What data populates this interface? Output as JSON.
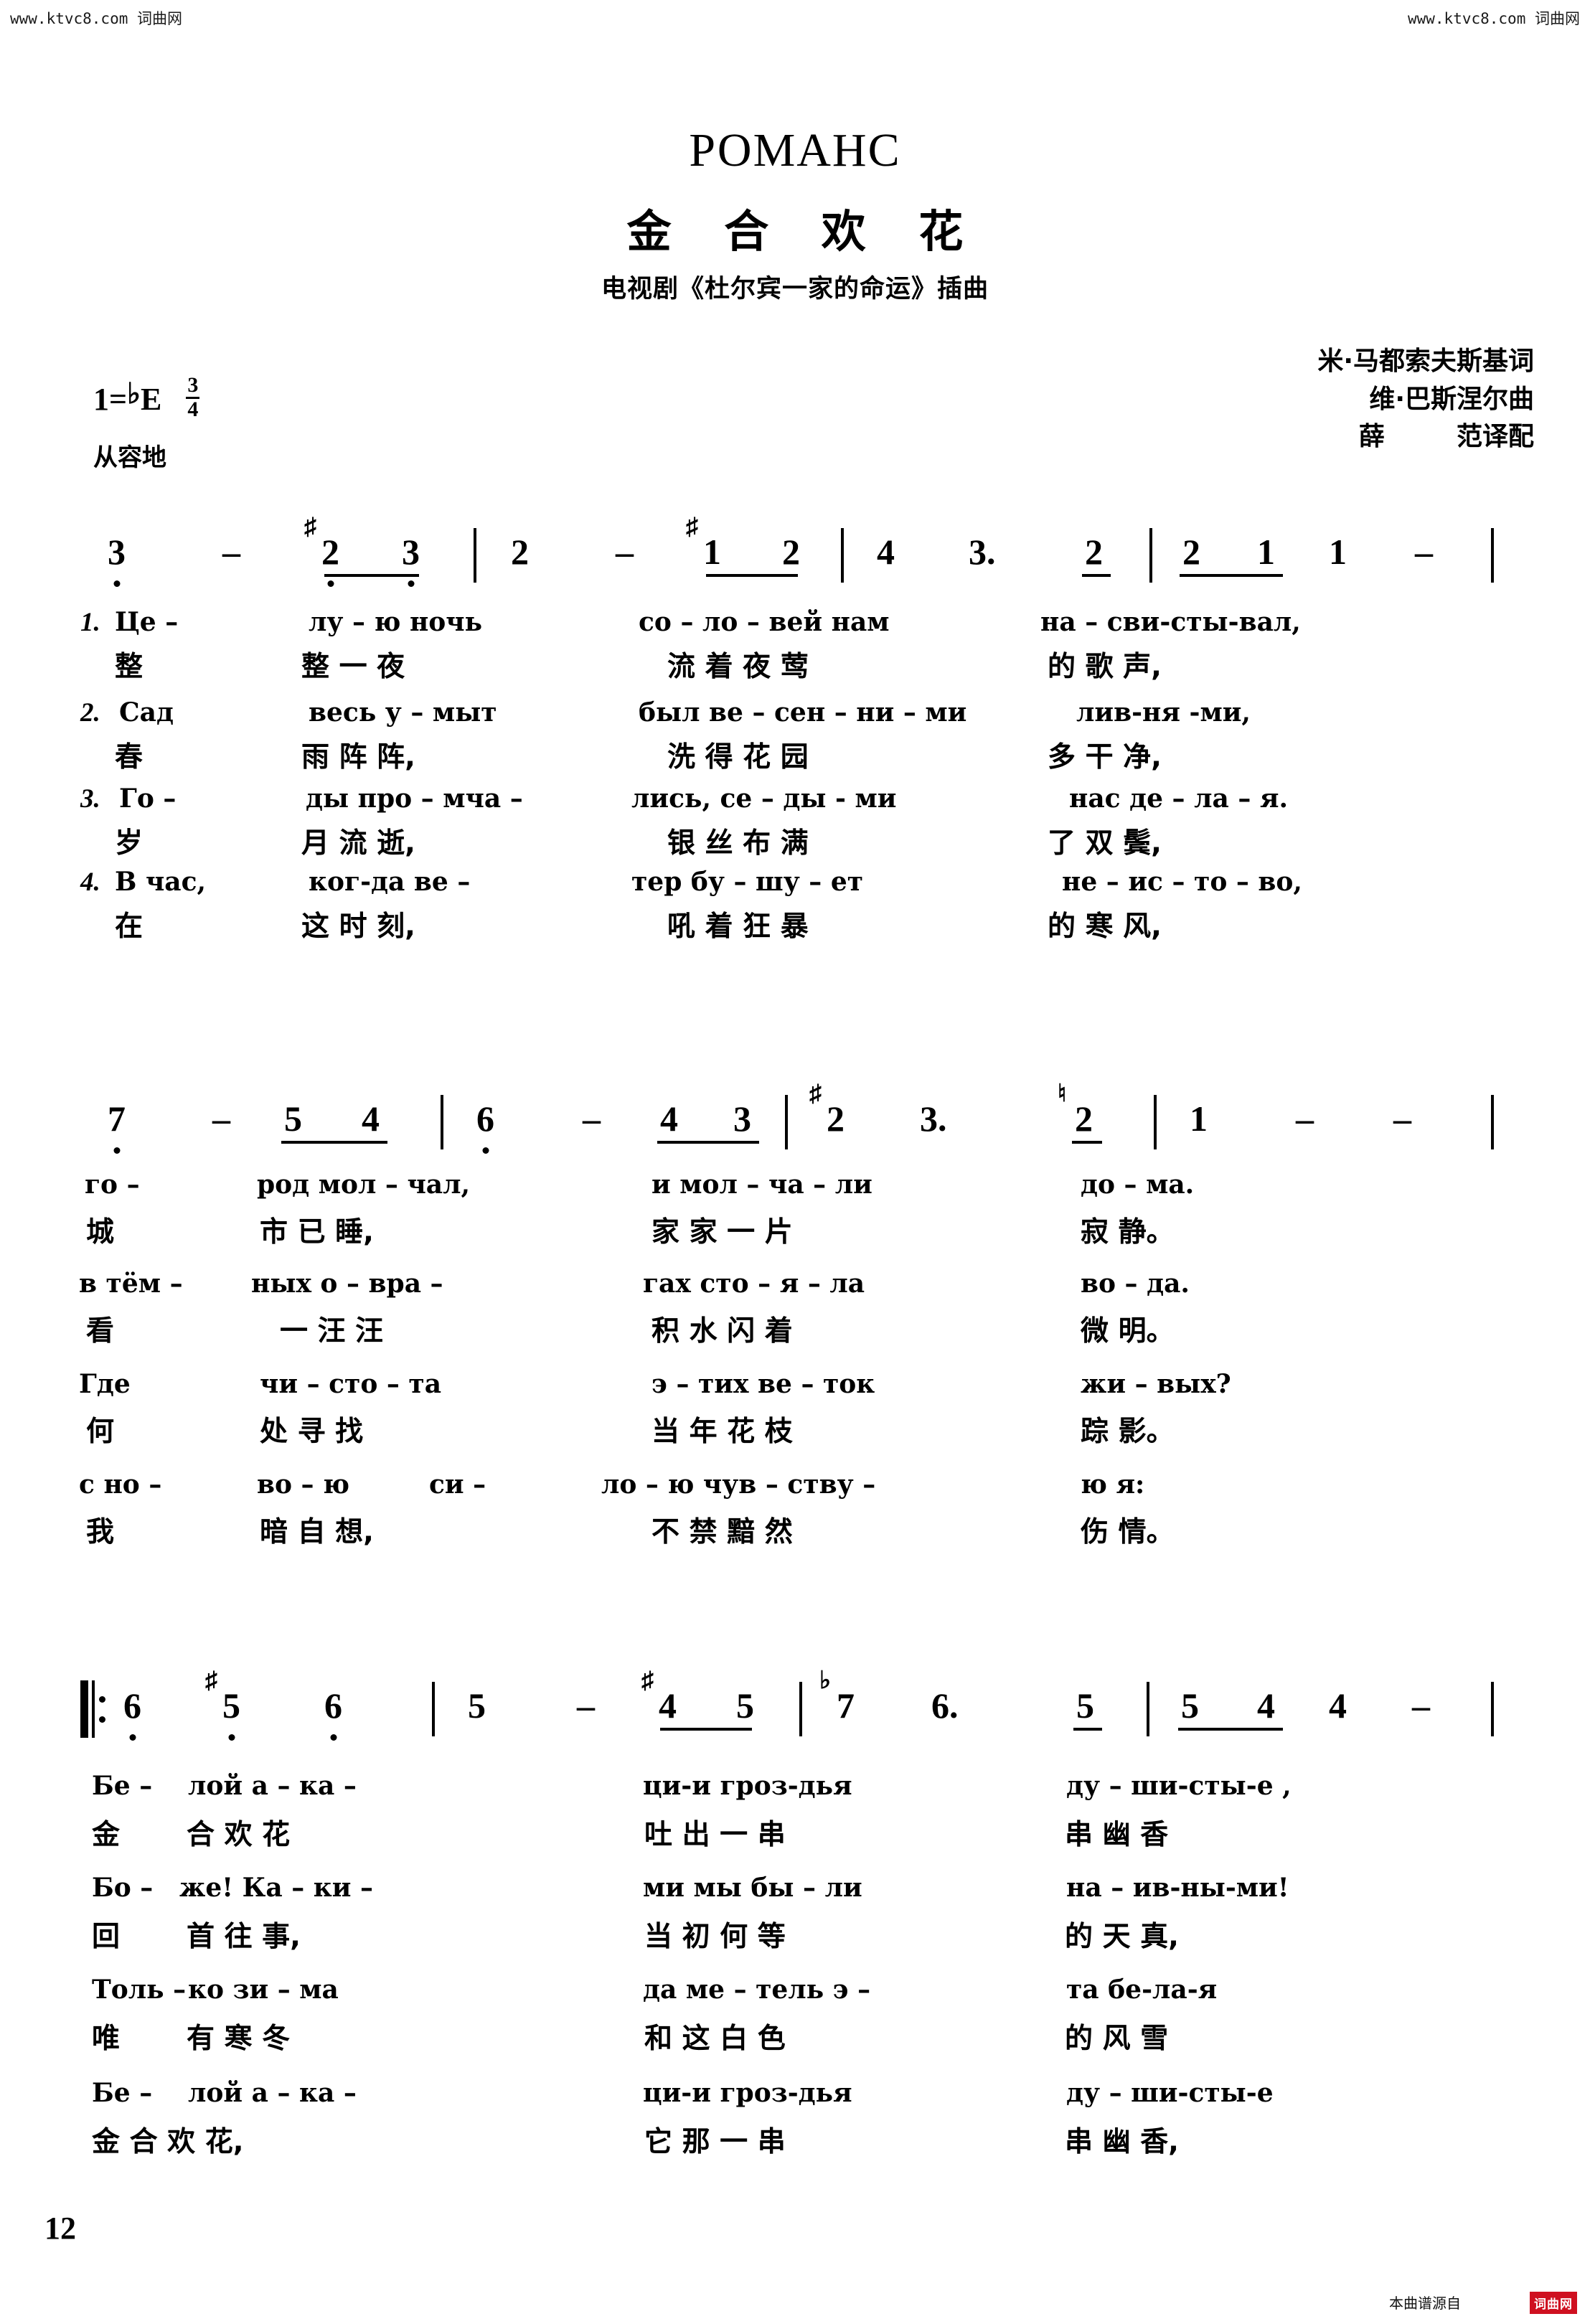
{
  "watermark": {
    "left": "www.ktvc8.com 词曲网",
    "right": "www.ktvc8.com 词曲网"
  },
  "header": {
    "title_ru": "РОМАНС",
    "title_cn": "金 合 欢 花",
    "subtitle_cn": "电视剧《杜尔宾一家的命运》插曲"
  },
  "credits": {
    "lyricist": "米·马都索夫斯基词",
    "composer": "维·巴斯涅尔曲",
    "translator": "薛        范译配"
  },
  "keysignature": {
    "tonic_label": "1",
    "equals": "=",
    "flat": "♭",
    "key": "E",
    "time_num": "3",
    "time_den": "4",
    "tempo_cn": "从容地"
  },
  "chart_data": {
    "type": "table",
    "title": "РОМАНС / 金 合 欢 花 — jianpu numbered notation",
    "key": "1=♭E",
    "time_signature": "3/4",
    "tempo": "从容地",
    "systems": [
      {
        "index": 1,
        "measures": [
          {
            "notes": [
              {
                "num": "3",
                "accidental": "",
                "octave": "low",
                "dur_dot": false,
                "beam": ""
              },
              {
                "num": "-",
                "accidental": "",
                "octave": "",
                "dur_dot": false,
                "beam": ""
              },
              {
                "num": "2",
                "accidental": "♯",
                "octave": "low",
                "dur_dot": false,
                "beam": "start"
              },
              {
                "num": "3",
                "accidental": "",
                "octave": "low",
                "dur_dot": false,
                "beam": "end"
              }
            ]
          },
          {
            "notes": [
              {
                "num": "2",
                "accidental": "",
                "octave": "",
                "dur_dot": false,
                "beam": ""
              },
              {
                "num": "-",
                "accidental": "",
                "octave": "",
                "dur_dot": false,
                "beam": ""
              },
              {
                "num": "1",
                "accidental": "♯",
                "octave": "",
                "dur_dot": false,
                "beam": "start"
              },
              {
                "num": "2",
                "accidental": "",
                "octave": "",
                "dur_dot": false,
                "beam": "end"
              }
            ]
          },
          {
            "notes": [
              {
                "num": "4",
                "accidental": "",
                "octave": "",
                "dur_dot": false,
                "beam": ""
              },
              {
                "num": "3",
                "accidental": "",
                "octave": "",
                "dur_dot": true,
                "beam": ""
              },
              {
                "num": "2",
                "accidental": "",
                "octave": "",
                "dur_dot": false,
                "beam": "single"
              }
            ]
          },
          {
            "notes": [
              {
                "num": "2",
                "accidental": "",
                "octave": "",
                "dur_dot": false,
                "beam": "start"
              },
              {
                "num": "1",
                "accidental": "",
                "octave": "",
                "dur_dot": false,
                "beam": "end"
              },
              {
                "num": "1",
                "accidental": "",
                "octave": "",
                "dur_dot": false,
                "beam": ""
              },
              {
                "num": "-",
                "accidental": "",
                "octave": "",
                "dur_dot": false,
                "beam": ""
              }
            ]
          }
        ]
      },
      {
        "index": 2,
        "measures": [
          {
            "notes": [
              {
                "num": "7",
                "accidental": "",
                "octave": "low",
                "dur_dot": false,
                "beam": ""
              },
              {
                "num": "-",
                "accidental": "",
                "octave": "",
                "dur_dot": false,
                "beam": ""
              },
              {
                "num": "5",
                "accidental": "",
                "octave": "",
                "dur_dot": false,
                "beam": "start"
              },
              {
                "num": "4",
                "accidental": "",
                "octave": "",
                "dur_dot": false,
                "beam": "end"
              }
            ]
          },
          {
            "notes": [
              {
                "num": "6",
                "accidental": "",
                "octave": "low",
                "dur_dot": false,
                "beam": ""
              },
              {
                "num": "-",
                "accidental": "",
                "octave": "",
                "dur_dot": false,
                "beam": ""
              },
              {
                "num": "4",
                "accidental": "",
                "octave": "",
                "dur_dot": false,
                "beam": "start"
              },
              {
                "num": "3",
                "accidental": "",
                "octave": "",
                "dur_dot": false,
                "beam": "end"
              }
            ]
          },
          {
            "notes": [
              {
                "num": "2",
                "accidental": "♯",
                "octave": "",
                "dur_dot": false,
                "beam": ""
              },
              {
                "num": "3",
                "accidental": "",
                "octave": "",
                "dur_dot": true,
                "beam": ""
              },
              {
                "num": "2",
                "accidental": "♮",
                "octave": "",
                "dur_dot": false,
                "beam": "single"
              }
            ]
          },
          {
            "notes": [
              {
                "num": "1",
                "accidental": "",
                "octave": "",
                "dur_dot": false,
                "beam": ""
              },
              {
                "num": "-",
                "accidental": "",
                "octave": "",
                "dur_dot": false,
                "beam": ""
              },
              {
                "num": "-",
                "accidental": "",
                "octave": "",
                "dur_dot": false,
                "beam": ""
              }
            ]
          }
        ]
      },
      {
        "index": 3,
        "repeat_start": true,
        "measures": [
          {
            "notes": [
              {
                "num": "6",
                "accidental": "",
                "octave": "low",
                "dur_dot": false,
                "beam": ""
              },
              {
                "num": "5",
                "accidental": "♯",
                "octave": "low",
                "dur_dot": false,
                "beam": ""
              },
              {
                "num": "6",
                "accidental": "",
                "octave": "low",
                "dur_dot": false,
                "beam": ""
              }
            ]
          },
          {
            "notes": [
              {
                "num": "5",
                "accidental": "",
                "octave": "",
                "dur_dot": false,
                "beam": ""
              },
              {
                "num": "-",
                "accidental": "",
                "octave": "",
                "dur_dot": false,
                "beam": ""
              },
              {
                "num": "4",
                "accidental": "♯",
                "octave": "",
                "dur_dot": false,
                "beam": "start"
              },
              {
                "num": "5",
                "accidental": "",
                "octave": "",
                "dur_dot": false,
                "beam": "end"
              }
            ]
          },
          {
            "notes": [
              {
                "num": "7",
                "accidental": "♭",
                "octave": "",
                "dur_dot": false,
                "beam": ""
              },
              {
                "num": "6",
                "accidental": "",
                "octave": "",
                "dur_dot": true,
                "beam": ""
              },
              {
                "num": "5",
                "accidental": "",
                "octave": "",
                "dur_dot": false,
                "beam": "single"
              }
            ]
          },
          {
            "notes": [
              {
                "num": "5",
                "accidental": "",
                "octave": "",
                "dur_dot": false,
                "beam": "start"
              },
              {
                "num": "4",
                "accidental": "",
                "octave": "",
                "dur_dot": false,
                "beam": "end"
              },
              {
                "num": "4",
                "accidental": "",
                "octave": "",
                "dur_dot": false,
                "beam": ""
              },
              {
                "num": "-",
                "accidental": "",
                "octave": "",
                "dur_dot": false,
                "beam": ""
              }
            ]
          }
        ]
      }
    ]
  },
  "lyrics": {
    "section1": [
      {
        "number": "1.",
        "ru": [
          "Це  –",
          "лу – ю    ночь",
          "со – ло – вей    нам",
          "на  – сви-сты-вал,"
        ],
        "cn": [
          "整",
          "整  一  夜",
          "流  着  夜  莺",
          "的    歌      声,"
        ]
      },
      {
        "number": "2.",
        "ru": [
          "Сад",
          "весь  у – мыт",
          "был ве –  сен – ни  –  ми",
          "лив-ня -ми,"
        ],
        "cn": [
          "春",
          "雨  阵  阵,",
          "洗  得  花  园",
          "多    干      净,"
        ]
      },
      {
        "number": "3.",
        "ru": [
          "Го   –",
          "ды про – мча –",
          "лись, се  –  ды - ми",
          "нас  де – ла – я."
        ],
        "cn": [
          "岁",
          "月  流  逝,",
          "银  丝  布  满",
          "了    双      鬓,"
        ]
      },
      {
        "number": "4.",
        "ru": [
          "В час,",
          "ког-да   ве  –",
          "тер бу  –  шу – ет",
          "не – ис – то – во,"
        ],
        "cn": [
          "在",
          "这  时  刻,",
          "吼  着  狂  暴",
          "的    寒      风,"
        ]
      }
    ],
    "section2": [
      {
        "ru": [
          "го     –",
          "род мол   – чал,",
          "и  мол – ча – ли",
          "до –  ма."
        ],
        "cn": [
          "城",
          "市  已  睡,",
          "家 家  一  片",
          "寂    静。"
        ]
      },
      {
        "ru": [
          "в тём –",
          "ных  о  – вра  –",
          "гах сто – я – ла",
          "во –  да."
        ],
        "cn": [
          "看",
          "一  汪  汪",
          "积  水  闪  着",
          "微    明。"
        ]
      },
      {
        "ru": [
          "Где",
          "чи – сто  –  та",
          "э – тих   ве – ток",
          "жи – вых?"
        ],
        "cn": [
          "何",
          "处  寻  找",
          "当  年  花  枝",
          "踪    影。"
        ]
      },
      {
        "ru": [
          "с но  –",
          "во – ю",
          "си    –",
          "ло – ю    чув – ству –",
          "ю        я:"
        ],
        "cn": [
          "我",
          "暗  自  想,",
          "不  禁  黯  然",
          "伤    情。"
        ]
      }
    ],
    "section3": [
      {
        "ru": [
          "Бе  –",
          "лой    а     –     ка    –",
          "ци-и   гроз-дья",
          "ду –  ши-сты-е ,"
        ],
        "cn": [
          "金",
          "合  欢  花",
          "吐 出  一  串",
          "串  幽   香"
        ]
      },
      {
        "ru": [
          "Бо –",
          "же!  Ка –  ки   –",
          "ми мы   бы – ли",
          "на – ив-ны-ми!"
        ],
        "cn": [
          "回",
          "首  往  事,",
          "当 初  何  等",
          "的  天   真,"
        ]
      },
      {
        "ru": [
          "Толь –",
          "ко    зи   –    ма",
          "да ме – тель э –",
          "та    бе-ла-я"
        ],
        "cn": [
          "唯",
          "有  寒  冬",
          "和 这  白  色",
          "的  风   雪"
        ]
      },
      {
        "ru": [
          "Бе  –",
          "лой    а     –     ка    –",
          "ци-и   гроз-дья",
          "ду –  ши-сты-е"
        ],
        "cn": [
          "金  合  欢  花,",
          "它 那  一  串",
          "串  幽   香,"
        ]
      }
    ]
  },
  "footer": {
    "page_number": "12",
    "source_text": "本曲谱源自",
    "logo_text": "词曲网"
  }
}
